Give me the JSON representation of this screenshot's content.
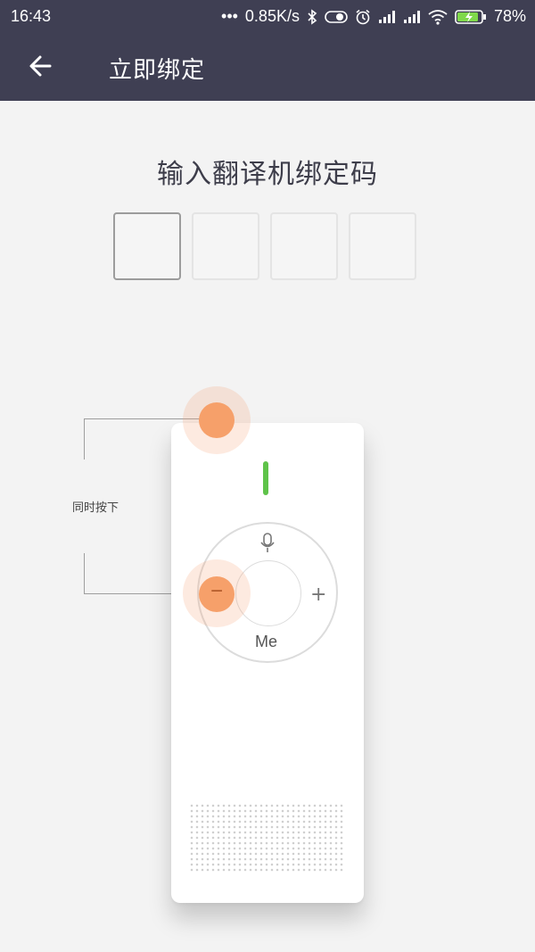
{
  "status_bar": {
    "time": "16:43",
    "dots": "•••",
    "network_speed": "0.85K/s",
    "battery_percent": "78%",
    "icons": [
      "bluetooth-icon",
      "toggle-icon",
      "alarm-icon",
      "signal-icon",
      "signal-icon",
      "wifi-icon",
      "battery-charging-icon"
    ]
  },
  "app_bar": {
    "title": "立即绑定",
    "back_icon": "arrow-left-icon"
  },
  "main": {
    "heading": "输入翻译机绑定码",
    "code_boxes": [
      "",
      "",
      "",
      ""
    ]
  },
  "device": {
    "me_label": "Me",
    "plus_label": "+",
    "minus_label": "−",
    "mic_icon": "microphone-icon",
    "led_color": "#5fc34a",
    "highlight_color": "#f6a06a"
  },
  "instruction": {
    "label": "同时按下"
  },
  "colors": {
    "header_bg": "#3f3f53",
    "page_bg": "#f3f3f3"
  }
}
